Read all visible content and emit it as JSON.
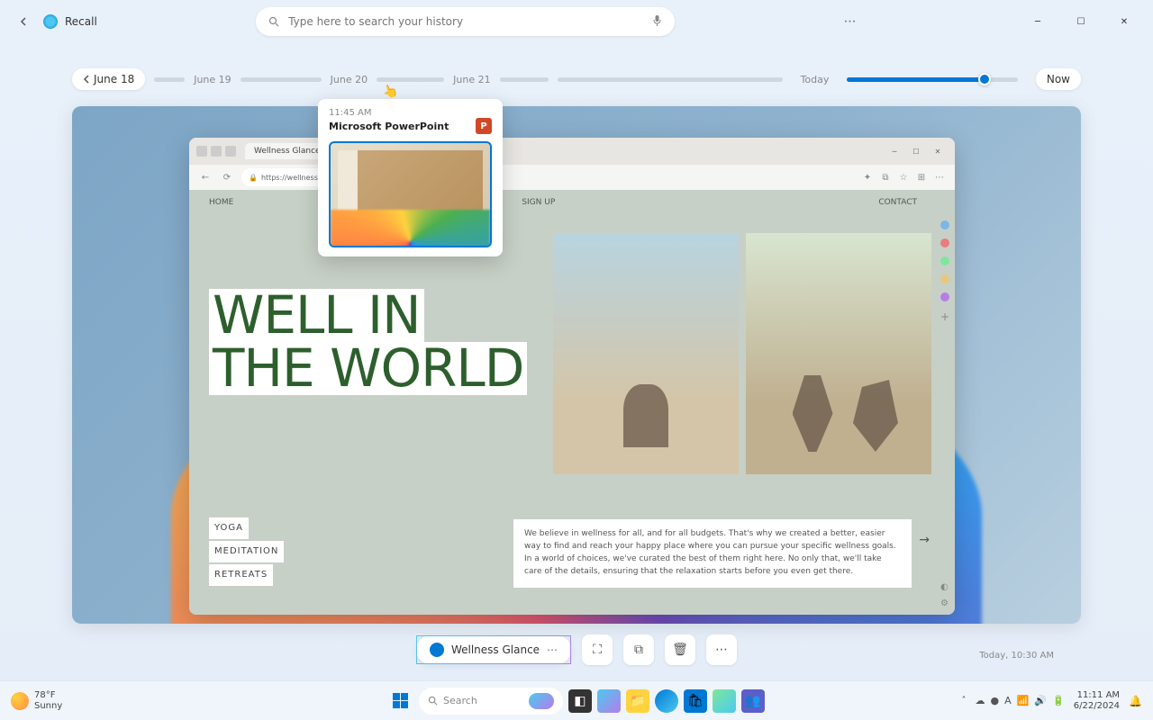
{
  "app": {
    "title": "Recall"
  },
  "search": {
    "placeholder": "Type here to search your history"
  },
  "timeline": {
    "current_date": "June 18",
    "dates": [
      "June 19",
      "June 20",
      "June 21"
    ],
    "today": "Today",
    "now": "Now"
  },
  "tooltip": {
    "time": "11:45 AM",
    "app": "Microsoft PowerPoint"
  },
  "browser": {
    "tab": "Wellness Glance",
    "url": "https://wellnessglance.com"
  },
  "page": {
    "nav": {
      "home": "HOME",
      "signup": "SIGN UP",
      "contact": "CONTACT"
    },
    "hero1": "WELL IN",
    "hero2": "THE WORLD",
    "links": {
      "yoga": "YOGA",
      "meditation": "MEDITATION",
      "retreats": "RETREATS"
    },
    "blurb": "We believe in wellness for all, and for all budgets. That's why we created a better, easier way to find and reach your happy place where you can pursue your specific wellness goals. In a world of choices, we've curated the best of them right here. No only that, we'll take care of the details, ensuring that the relaxation starts before you even get there."
  },
  "chip": {
    "label": "Wellness Glance"
  },
  "timestamp": "Today, 10:30 AM",
  "taskbar": {
    "temp": "78°F",
    "condition": "Sunny",
    "search": "Search",
    "time": "11:11 AM",
    "date": "6/22/2024"
  }
}
